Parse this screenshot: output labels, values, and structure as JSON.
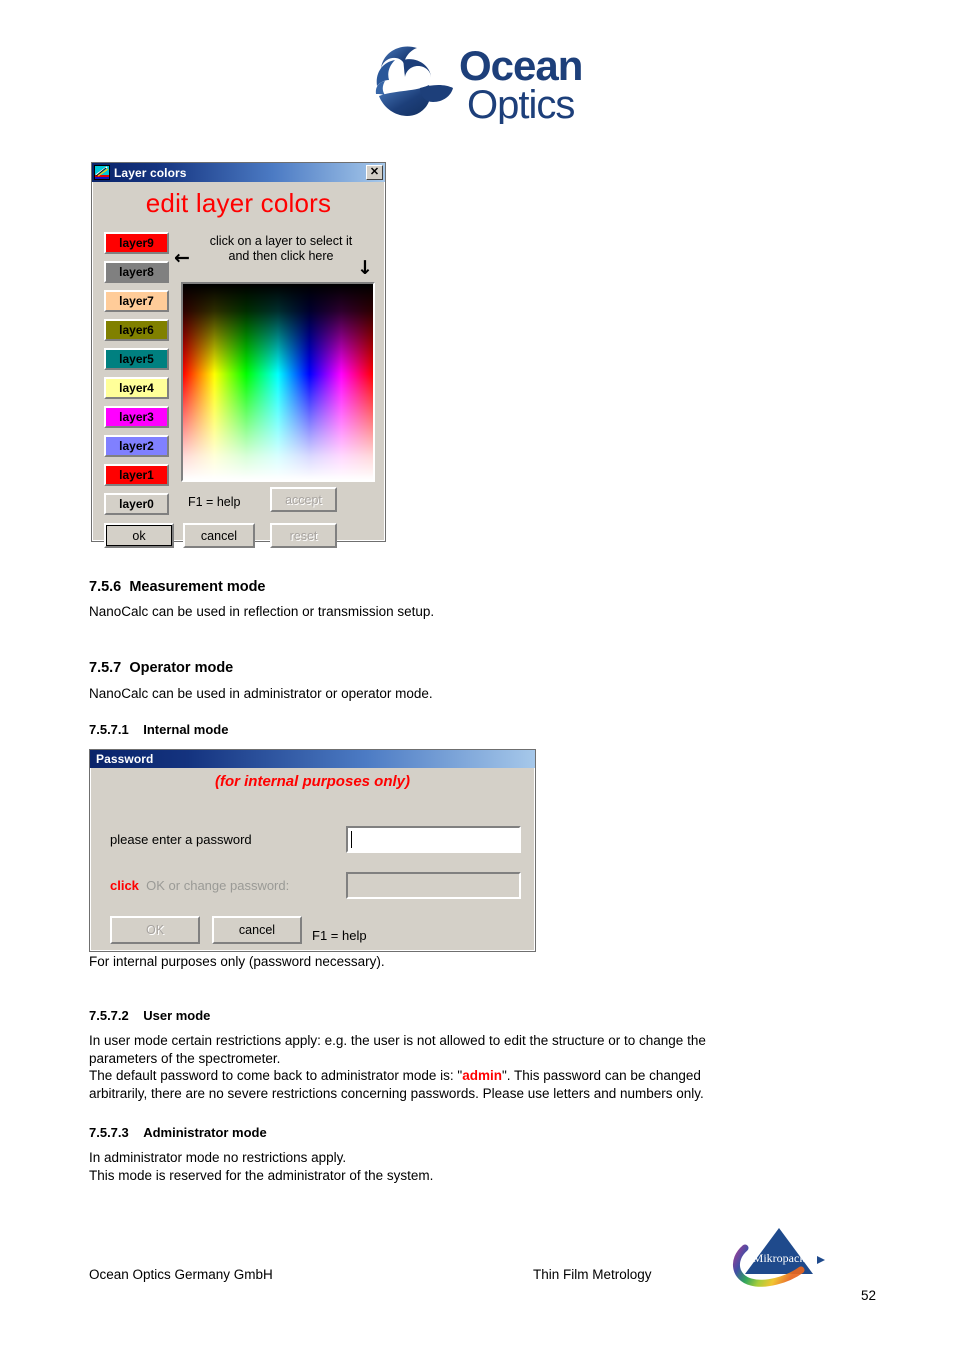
{
  "header": {
    "logo_alt": "Ocean Optics",
    "logo_line1": "Ocean",
    "logo_line2": "Optics",
    "logo_color": "#1d3f7a"
  },
  "layer_colors_dialog": {
    "title": "Layer colors",
    "icon": "spectrum-chart-icon",
    "close_label": "✕",
    "heading": "edit layer colors",
    "heading_color": "#ff0000",
    "hint_line1": "click on a layer to select it",
    "hint_line2": "and then click here",
    "arrow_left": "←",
    "arrow_down": "↓",
    "f1_help": "F1 = help",
    "layers": [
      {
        "label": "layer9",
        "color": "#ff0000",
        "text_color": "#000000"
      },
      {
        "label": "layer8",
        "color": "#808080",
        "text_color": "#000000"
      },
      {
        "label": "layer7",
        "color": "#ffcc99",
        "text_color": "#000000"
      },
      {
        "label": "layer6",
        "color": "#808000",
        "text_color": "#000000"
      },
      {
        "label": "layer5",
        "color": "#008080",
        "text_color": "#000000"
      },
      {
        "label": "layer4",
        "color": "#ffff99",
        "text_color": "#000000"
      },
      {
        "label": "layer3",
        "color": "#ff00ff",
        "text_color": "#000000"
      },
      {
        "label": "layer2",
        "color": "#8080ff",
        "text_color": "#000000"
      },
      {
        "label": "layer1",
        "color": "#ff0000",
        "text_color": "#000000"
      },
      {
        "label": "layer0",
        "color": "#d4d0c8",
        "text_color": "#000000"
      }
    ],
    "buttons": {
      "accept": "accept",
      "ok": "ok",
      "cancel": "cancel",
      "reset": "reset"
    }
  },
  "sections": {
    "s756_num": "7.5.6",
    "s756_title": "Measurement mode",
    "s756_body": "NanoCalc can be used in reflection or transmission setup.",
    "s757_num": "7.5.7",
    "s757_title": "Operator mode",
    "s757_body": "NanoCalc can be used in administrator or operator mode.",
    "s7571_num": "7.5.7.1",
    "s7571_title": "Internal mode",
    "s7571_body": "For internal purposes only (password necessary).",
    "s7572_num": "7.5.7.2",
    "s7572_title": "User mode",
    "s7572_body_line1": "In user mode certain restrictions apply: e.g. the user is not allowed to edit the structure or to change the",
    "s7572_body_line2": "parameters of the spectrometer.",
    "s7572_body_line3a": "The default password to come back to administrator mode is: \"",
    "s7572_body_admin": "admin",
    "s7572_body_line3b": "\". This password can be changed",
    "s7572_body_line4": "arbitrarily, there are no severe restrictions concerning passwords. Please use letters and numbers only.",
    "s7573_num": "7.5.7.3",
    "s7573_title": "Administrator mode",
    "s7573_body_line1": "In administrator mode no restrictions apply.",
    "s7573_body_line2": "This mode is reserved for the administrator of the system."
  },
  "password_dialog": {
    "title": "Password",
    "heading": "(for internal purposes only)",
    "heading_color": "#ff0000",
    "label_password": "please enter a password",
    "label_click": "click",
    "label_change": "OK or change password:",
    "input_password_value": "",
    "input_change_value": "",
    "buttons": {
      "ok": "OK",
      "cancel": "cancel"
    },
    "f1_help": "F1 = help"
  },
  "footer": {
    "left": "Ocean Optics Germany GmbH",
    "center": "Thin Film Metrology",
    "page_number": "52",
    "logo_text": "Mikropack",
    "logo_color": "#1f4a8c"
  }
}
